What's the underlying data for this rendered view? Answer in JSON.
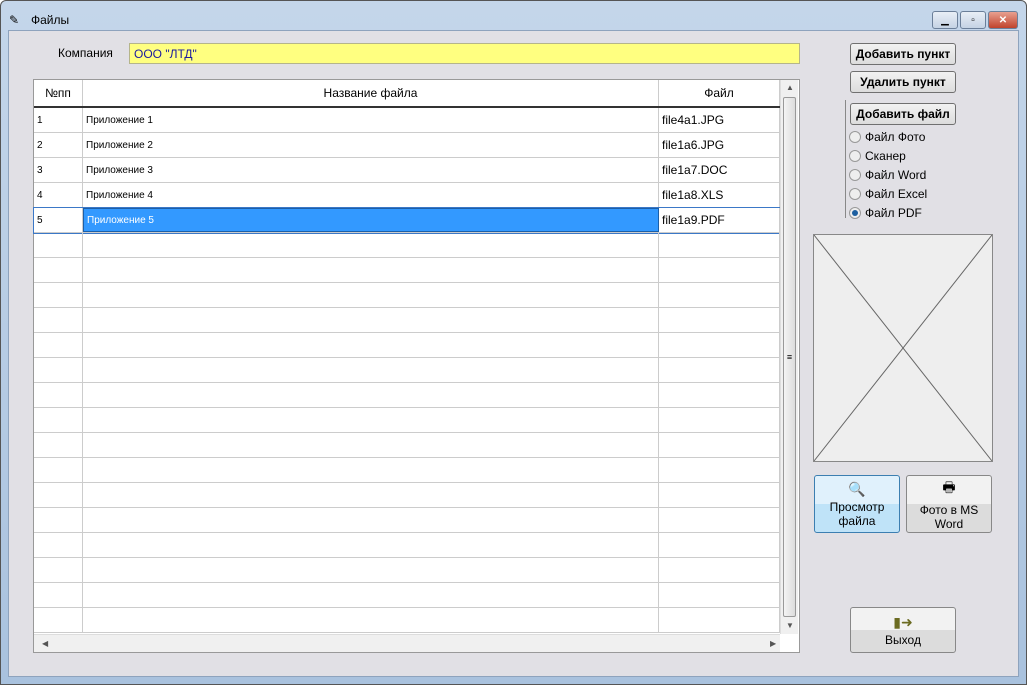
{
  "window": {
    "title": "Файлы"
  },
  "company": {
    "label": "Компания",
    "value": "ООО \"ЛТД\""
  },
  "table": {
    "headers": [
      "№пп",
      "Название файла",
      "Файл"
    ],
    "rows": [
      [
        "1",
        "Приложение 1",
        "file4a1.JPG"
      ],
      [
        "2",
        "Приложение 2",
        "file1a6.JPG"
      ],
      [
        "3",
        "Приложение 3",
        "file1a7.DOC"
      ],
      [
        "4",
        "Приложение 4",
        "file1a8.XLS"
      ],
      [
        "5",
        "Приложение 5",
        "file1a9.PDF"
      ]
    ],
    "selected_row": 5
  },
  "buttons": {
    "add_item": "Добавить пункт",
    "delete_item": "Удалить пункт",
    "add_file": "Добавить файл",
    "view_file": "Просмотр файла",
    "photo_word": "Фото в MS Word",
    "exit": "Выход"
  },
  "file_types": [
    {
      "label": "Файл Фото",
      "checked": false
    },
    {
      "label": "Сканер",
      "checked": false
    },
    {
      "label": "Файл Word",
      "checked": false
    },
    {
      "label": "Файл Excel",
      "checked": false
    },
    {
      "label": "Файл PDF",
      "checked": true
    }
  ]
}
